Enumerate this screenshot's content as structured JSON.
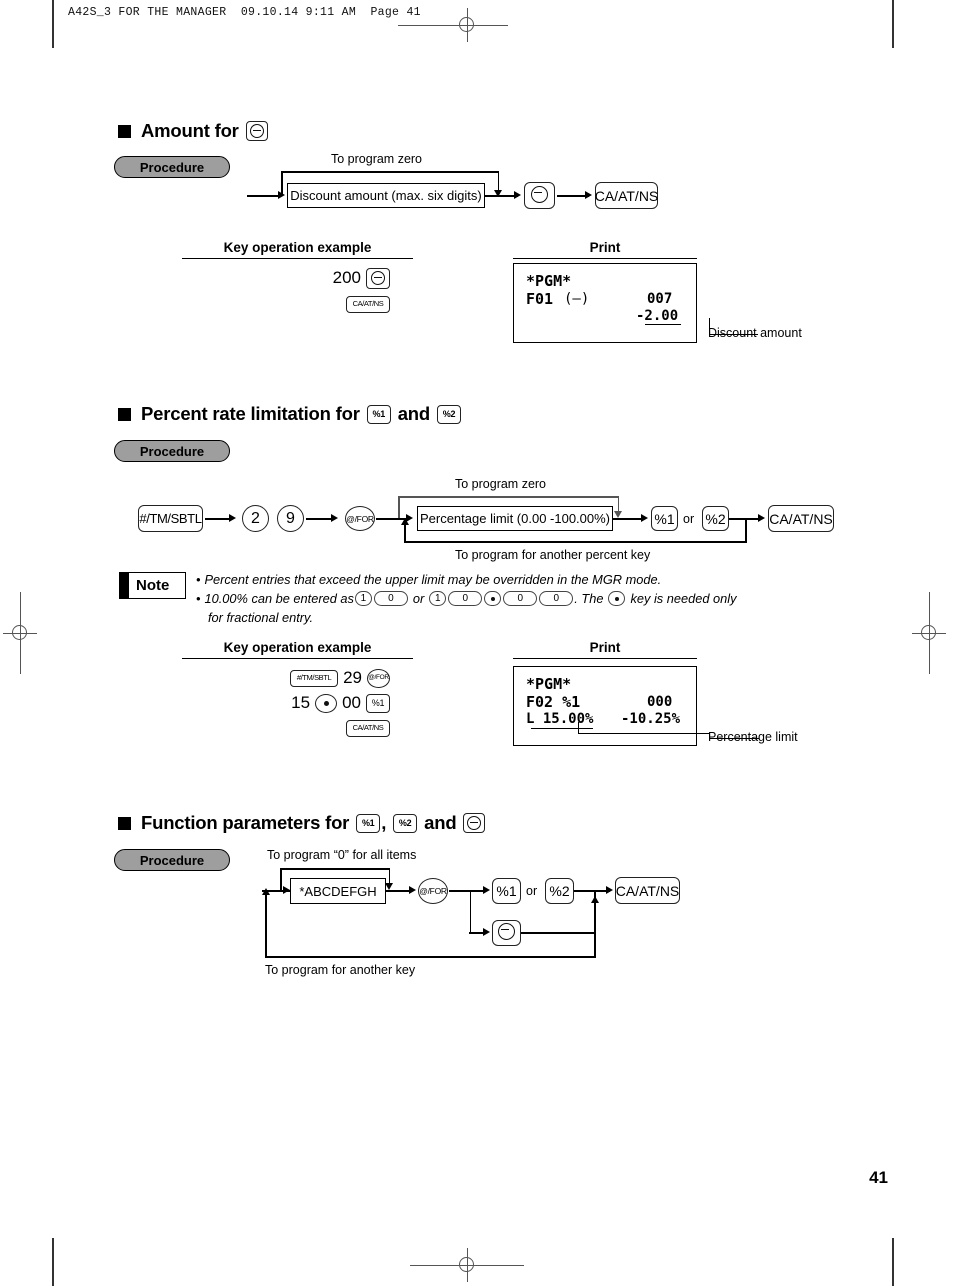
{
  "page": {
    "header_line": "A42S_3 FOR THE MANAGER  09.10.14 9:11 AM  Page 41",
    "page_number": "41"
  },
  "labels": {
    "procedure": "Procedure",
    "key_operation_example": "Key operation example",
    "print": "Print",
    "note": "Note",
    "or": "or"
  },
  "section1": {
    "heading_text": "Amount for",
    "heading_key": "minus-key",
    "flow": {
      "top_caption": "To program zero",
      "entry_box": "Discount amount (max. six digits)",
      "key_minus": "minus-key",
      "key_finish": "CA/AT/NS"
    },
    "example": {
      "amount": "200",
      "key_minus": "minus-key",
      "key_finish": "CA/AT/NS"
    },
    "receipt": {
      "line1": "*PGM*",
      "line2_left": "F01",
      "line2_mid": "(—)",
      "line2_right": "007",
      "line3_right": "-2.00"
    },
    "callout": "Discount amount"
  },
  "section2": {
    "heading_text": "Percent rate limitation for",
    "heading_and": "and",
    "heading_key1": "%1",
    "heading_key2": "%2",
    "flow": {
      "key_start": "#/TM/SBTL",
      "digit1": "2",
      "digit2": "9",
      "key_for": "@/FOR",
      "top_caption": "To program zero",
      "entry_box": "Percentage limit (0.00 -100.00%)",
      "key_pct1": "%1",
      "key_pct2": "%2",
      "key_finish": "CA/AT/NS",
      "bottom_caption": "To program for another percent key"
    },
    "notes": {
      "bullet1": "Percent entries that exceed the upper limit may be overridden in the MGR mode.",
      "bullet2_a": "10.00% can be entered as",
      "bullet2_keys_a": [
        "1",
        "0"
      ],
      "bullet2_or": "or",
      "bullet2_keys_b": [
        "1",
        "0",
        "·",
        "0",
        "0"
      ],
      "bullet2_b": ".  The",
      "bullet2_c": "key is needed only",
      "bullet2_d": "for fractional entry."
    },
    "example": {
      "key_start": "#/TM/SBTL",
      "digits1": "29",
      "key_for": "@/FOR",
      "digits2": "15",
      "key_dot": "decimal-point-key",
      "digits3": "00",
      "key_pct1": "%1",
      "key_finish": "CA/AT/NS"
    },
    "receipt": {
      "line1": "*PGM*",
      "line2_left": "F02 %1",
      "line2_right": "000",
      "line3_left": "L 15.00%",
      "line3_right": "-10.25%"
    },
    "callout": "Percentage limit"
  },
  "section3": {
    "heading_text": "Function parameters for",
    "heading_key1": "%1",
    "heading_comma": ",",
    "heading_key2": "%2",
    "heading_and": "and",
    "heading_key3": "minus-key",
    "flow": {
      "top_caption": "To program “0” for all items",
      "entry_box": "*ABCDEFGH",
      "key_for": "@/FOR",
      "key_pct1": "%1",
      "key_pct2": "%2",
      "key_minus": "minus-key",
      "key_finish": "CA/AT/NS",
      "bottom_caption": "To program for another key"
    }
  }
}
